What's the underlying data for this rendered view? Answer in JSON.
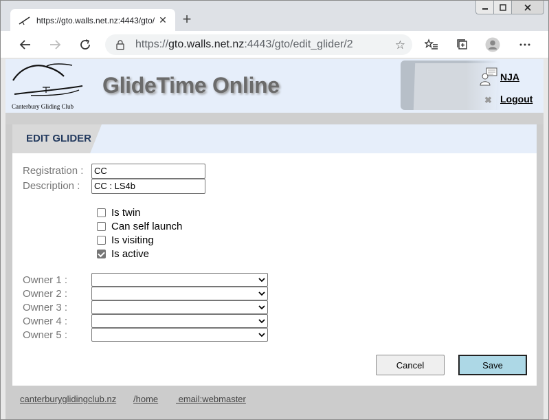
{
  "browser": {
    "tab_title": "https://gto.walls.net.nz:4443/gto/",
    "address_prefix": "https://",
    "address_host": "gto.walls.net.nz",
    "address_path": ":4443/gto/edit_glider/2"
  },
  "header": {
    "logo_text": "Canterbury  Gliding  Club",
    "app_title": "GlideTime Online",
    "user_name": "NJA",
    "logout_label": "Logout"
  },
  "section": {
    "title": "EDIT GLIDER"
  },
  "form": {
    "registration_label": "Registration :",
    "registration_value": "CC",
    "description_label": "Description :",
    "description_value": "CC : LS4b",
    "checkboxes": [
      {
        "label": "Is twin",
        "checked": false
      },
      {
        "label": "Can self launch",
        "checked": false
      },
      {
        "label": "Is visiting",
        "checked": false
      },
      {
        "label": "Is active",
        "checked": true
      }
    ],
    "owners": [
      {
        "label": "Owner 1 :",
        "value": ""
      },
      {
        "label": "Owner 2 :",
        "value": ""
      },
      {
        "label": "Owner 3 :",
        "value": ""
      },
      {
        "label": "Owner 4 :",
        "value": ""
      },
      {
        "label": "Owner 5 :",
        "value": ""
      }
    ],
    "cancel_label": "Cancel",
    "save_label": "Save"
  },
  "footer": {
    "links": [
      "canterburyglidingclub.nz",
      "/home",
      " email:webmaster"
    ]
  }
}
